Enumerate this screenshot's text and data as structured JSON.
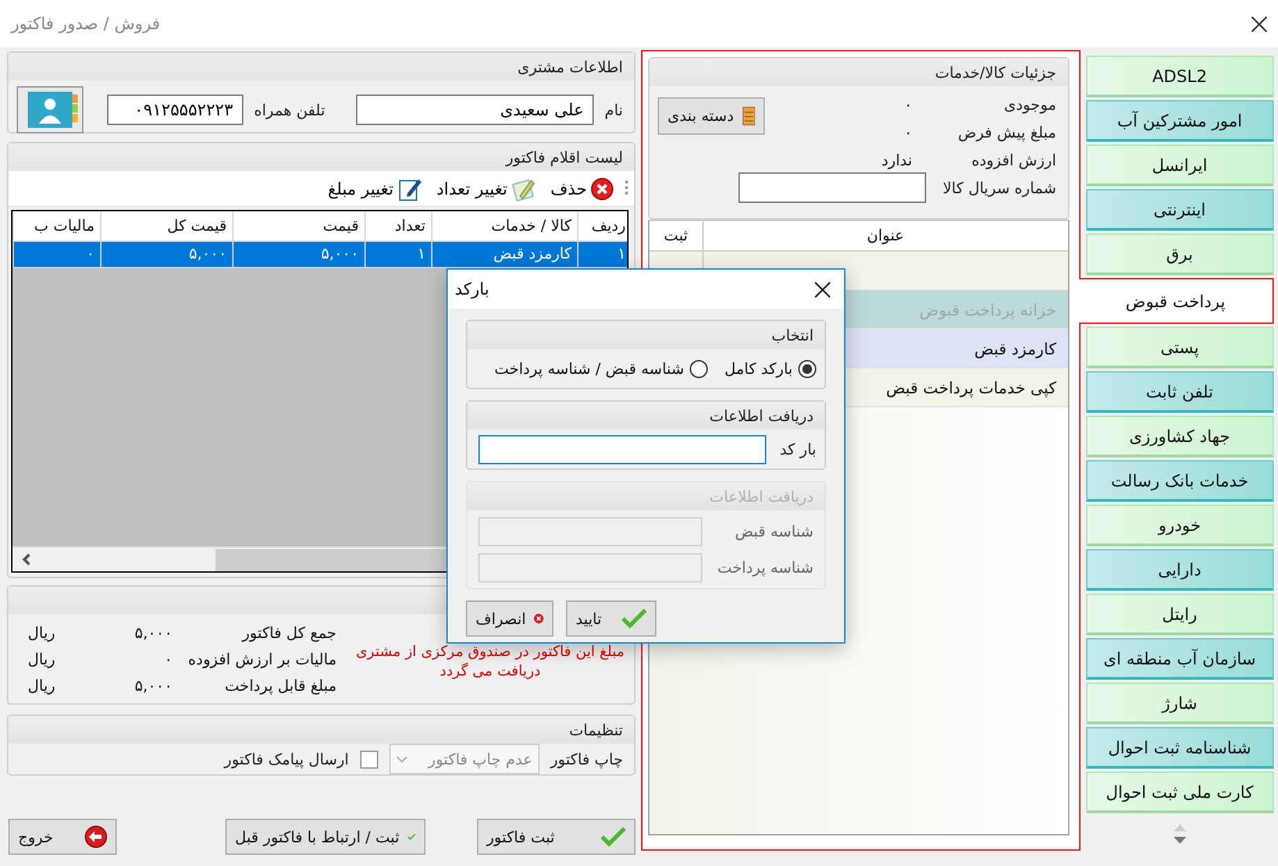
{
  "window": {
    "title": "فروش / صدور فاکتور"
  },
  "customer": {
    "title": "اطلاعات مشتری",
    "name_label": "نام",
    "name": "علی سعیدی",
    "phone_label": "تلفن همراه",
    "phone": "۰۹۱۲۵۵۵۲۲۲۳"
  },
  "items": {
    "title": "لیست اقلام فاکتور",
    "toolbar": [
      {
        "kind": "delete",
        "label": "حذف"
      },
      {
        "kind": "quantity",
        "label": "تغییر تعداد"
      },
      {
        "kind": "price",
        "label": "تغییر مبلغ"
      }
    ],
    "columns": [
      "ردیف",
      "کالا / خدمات",
      "تعداد",
      "قیمت",
      "قیمت کل",
      "مالیات ب"
    ],
    "rows": [
      {
        "cells": [
          "۱",
          "کارمزد قبض",
          "۱",
          "۵,۰۰۰",
          "۵,۰۰۰",
          "۰"
        ],
        "selected": true
      }
    ]
  },
  "totals": {
    "rows": [
      {
        "label": "جمع کل فاکتور",
        "value": "۵,۰۰۰",
        "unit": "ریال"
      },
      {
        "label": "مالیات بر ارزش افزوده",
        "value": "۰",
        "unit": "ریال"
      },
      {
        "label": "مبلغ قابل پرداخت",
        "value": "۵,۰۰۰",
        "unit": "ریال"
      }
    ],
    "note": "مبلغ این فاکتور در صندوق مرکزی از مشتری دریافت می گردد"
  },
  "settings": {
    "title": "تنظیمات",
    "print_label": "چاپ فاکتور",
    "print_value": "عدم چاپ فاکتور",
    "print_disabled": true,
    "sms_label": "ارسال پیامک فاکتور",
    "sms_checked": false
  },
  "footer_buttons": [
    {
      "kind": "save",
      "label": "ثبت فاکتور"
    },
    {
      "kind": "link",
      "label": "ثبت / ارتباط با فاکتور قبل"
    },
    {
      "kind": "exit",
      "label": "خروج"
    }
  ],
  "details": {
    "title": "جزئیات کالا/خدمات",
    "fields": [
      {
        "label": "موجودی",
        "value": "۰"
      },
      {
        "label": "مبلغ پیش فرض",
        "value": "۰"
      },
      {
        "label": "ارزش افزوده",
        "value": "ندارد"
      }
    ],
    "serial_label": "شماره سریال کالا",
    "category_button": "دسته بندی",
    "columns": [
      "عنوان",
      "ثبت"
    ],
    "rows": [
      {
        "kind": "blank",
        "selected": false
      },
      {
        "kind": "group",
        "title": "خزانه پرداخت قبوض",
        "selected": false
      },
      {
        "kind": "item",
        "title": "کارمزد قبض",
        "selected": true
      },
      {
        "kind": "item",
        "title": "کپی خدمات پرداخت قبض",
        "selected": false
      }
    ]
  },
  "categories": [
    {
      "label": "ADSL2",
      "selected": false
    },
    {
      "label": "امور مشترکین آب",
      "selected": false
    },
    {
      "label": "ایرانسل",
      "selected": false
    },
    {
      "label": "اینترنتی",
      "selected": false
    },
    {
      "label": "برق",
      "selected": false
    },
    {
      "label": "پرداخت قبوض",
      "selected": true
    },
    {
      "label": "پستی",
      "selected": false
    },
    {
      "label": "تلفن ثابت",
      "selected": false
    },
    {
      "label": "جهاد کشاورزی",
      "selected": false
    },
    {
      "label": "خدمات بانک رسالت",
      "selected": false
    },
    {
      "label": "خودرو",
      "selected": false
    },
    {
      "label": "دارایی",
      "selected": false
    },
    {
      "label": "رایتل",
      "selected": false
    },
    {
      "label": "سازمان آب منطقه ای",
      "selected": false
    },
    {
      "label": "شارژ",
      "selected": false
    },
    {
      "label": "شناسنامه ثبت احوال",
      "selected": false
    },
    {
      "label": "کارت ملی ثبت احوال",
      "selected": false
    }
  ],
  "dialog": {
    "title": "بارکد",
    "choice_title": "انتخاب",
    "options": [
      {
        "label": "بارکد کامل",
        "selected": true
      },
      {
        "label": "شناسه قبض / شناسه پرداخت",
        "selected": false
      }
    ],
    "input_title": "دریافت اطلاعات",
    "barcode_label": "بار کد",
    "ids_title": "دریافت اطلاعات",
    "ids_disabled": true,
    "bill_id_label": "شناسه قبض",
    "payment_id_label": "شناسه پرداخت",
    "buttons": [
      {
        "kind": "ok",
        "label": "تایید"
      },
      {
        "kind": "cancel",
        "label": "انصراف"
      }
    ]
  }
}
